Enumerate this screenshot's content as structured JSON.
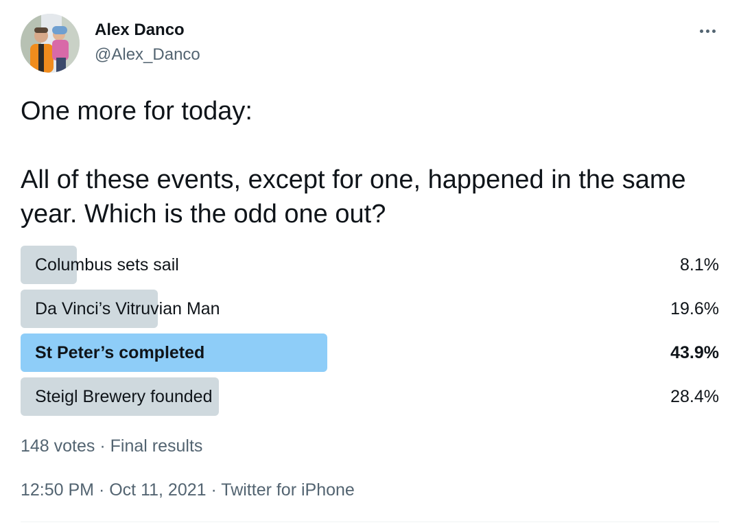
{
  "author": {
    "display_name": "Alex Danco",
    "handle": "@Alex_Danco"
  },
  "tweet": {
    "lines": [
      "One more for today:",
      "All of these events, except for one, happened in the same year. Which is the odd one out?"
    ]
  },
  "poll": {
    "options": [
      {
        "label": "Columbus sets sail",
        "percent": "8.1%",
        "share": 0.081,
        "winner": false
      },
      {
        "label": "Da Vinci’s Vitruvian Man",
        "percent": "19.6%",
        "share": 0.196,
        "winner": false
      },
      {
        "label": "St Peter’s completed",
        "percent": "43.9%",
        "share": 0.439,
        "winner": true
      },
      {
        "label": "Steigl Brewery founded",
        "percent": "28.4%",
        "share": 0.284,
        "winner": false
      }
    ],
    "votes": "148 votes",
    "separator": " · ",
    "status": "Final results"
  },
  "timestamp": {
    "time": "12:50 PM",
    "date": "Oct 11, 2021",
    "source": "Twitter for iPhone",
    "separator": " · "
  },
  "colors": {
    "bar_default": "#cfd9de",
    "bar_winner": "#8ecdf8",
    "secondary_text": "#536471"
  },
  "icons": {
    "more": "more-horizontal-icon"
  }
}
